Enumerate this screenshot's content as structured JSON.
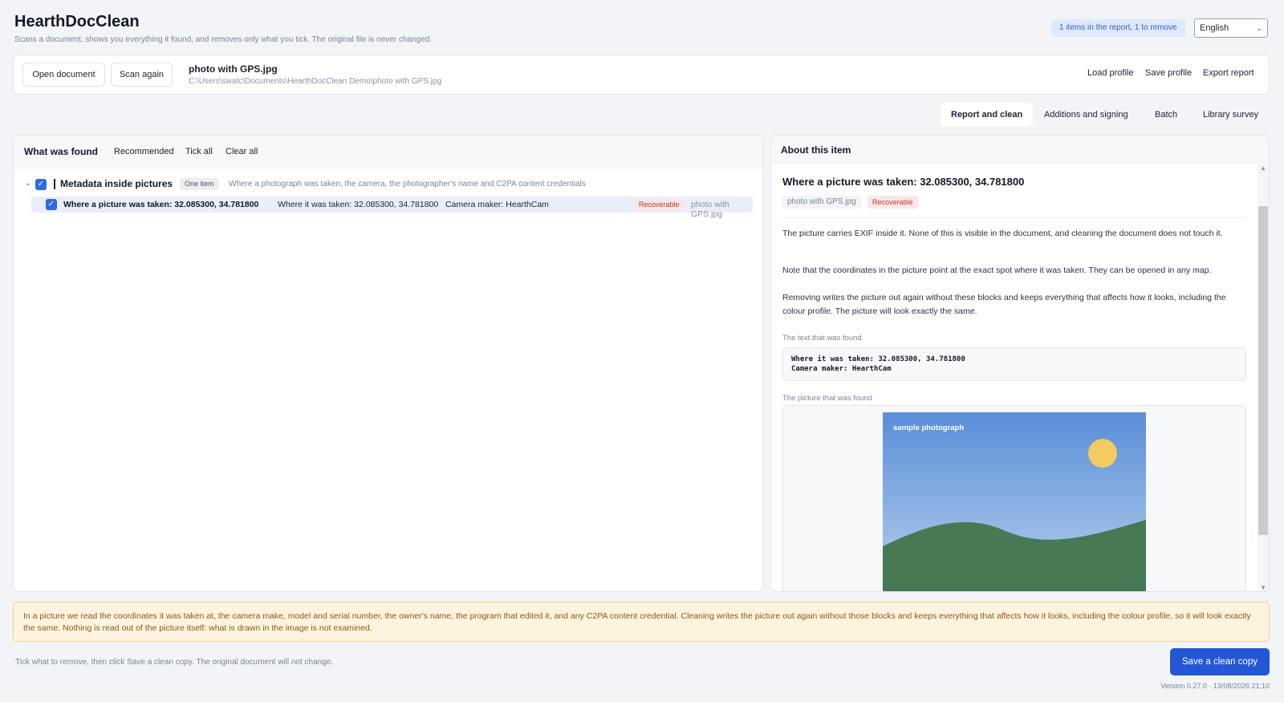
{
  "header": {
    "title": "HearthDocClean",
    "subtitle": "Scans a document, shows you everything it found, and removes only what you tick. The original file is never changed.",
    "report_status": "1 items in the report, 1 to remove",
    "language": "English"
  },
  "filebar": {
    "open_label": "Open document",
    "rescan_label": "Scan again",
    "file_name": "photo with GPS.jpg",
    "file_path": "C:\\Users\\swatc\\Documents\\HearthDocClean Demo\\photo with GPS.jpg",
    "load_profile": "Load profile",
    "save_profile": "Save profile",
    "export_report": "Export report"
  },
  "tabs": [
    {
      "label": "Report and clean",
      "active": true
    },
    {
      "label": "Additions and signing",
      "active": false
    },
    {
      "label": "Batch",
      "active": false
    },
    {
      "label": "Library survey",
      "active": false
    }
  ],
  "found": {
    "title": "What was found",
    "recommended": "Recommended",
    "tick_all": "Tick all",
    "clear_all": "Clear all",
    "group": {
      "label": "Metadata inside pictures",
      "count": "One item",
      "description": "Where a photograph was taken, the camera, the photographer's name and C2PA content credentials",
      "checked": true
    },
    "items": [
      {
        "title": "Where a picture was taken: 32.085300, 34.781800",
        "detail": "Where it was taken: 32.085300, 34.781800   Camera maker: HearthCam",
        "badge": "Recoverable",
        "source": "photo with GPS.jpg",
        "checked": true
      }
    ]
  },
  "about": {
    "title": "About this item",
    "item_title": "Where a picture was taken: 32.085300, 34.781800",
    "file": "photo with GPS.jpg",
    "badge": "Recoverable",
    "para1": "The picture carries EXIF inside it. None of this is visible in the document, and cleaning the document does not touch it.",
    "para2": "Note that the coordinates in the picture point at the exact spot where it was taken. They can be opened in any map.",
    "para3": "Removing writes the picture out again without these blocks and keeps everything that affects how it looks, including the colour profile. The picture will look exactly the same.",
    "text_caption": "The text that was found",
    "text_found": "Where it was taken: 32.085300, 34.781800\nCamera maker: HearthCam",
    "picture_caption": "The picture that was found",
    "picture_label": "sample photograph"
  },
  "notice": "In a picture we read the coordinates it was taken at, the camera make, model and serial number, the owner's name, the program that edited it, and any C2PA content credential. Cleaning writes the picture out again without those blocks and keeps everything that affects how it looks, including the colour profile, so it will look exactly the same. Nothing is read out of the picture itself: what is drawn in the image is not examined.",
  "footer": {
    "hint": "Tick what to remove, then click Save a clean copy. The original document will not change.",
    "save_button": "Save a clean copy",
    "version": "Version 0.27.0  ·  13/08/2026 21:10"
  },
  "colors": {
    "accent": "#2457d6",
    "checkbox": "#2d6be0",
    "badge_red": "#c2352f",
    "notice_bg": "#fdf3df"
  }
}
